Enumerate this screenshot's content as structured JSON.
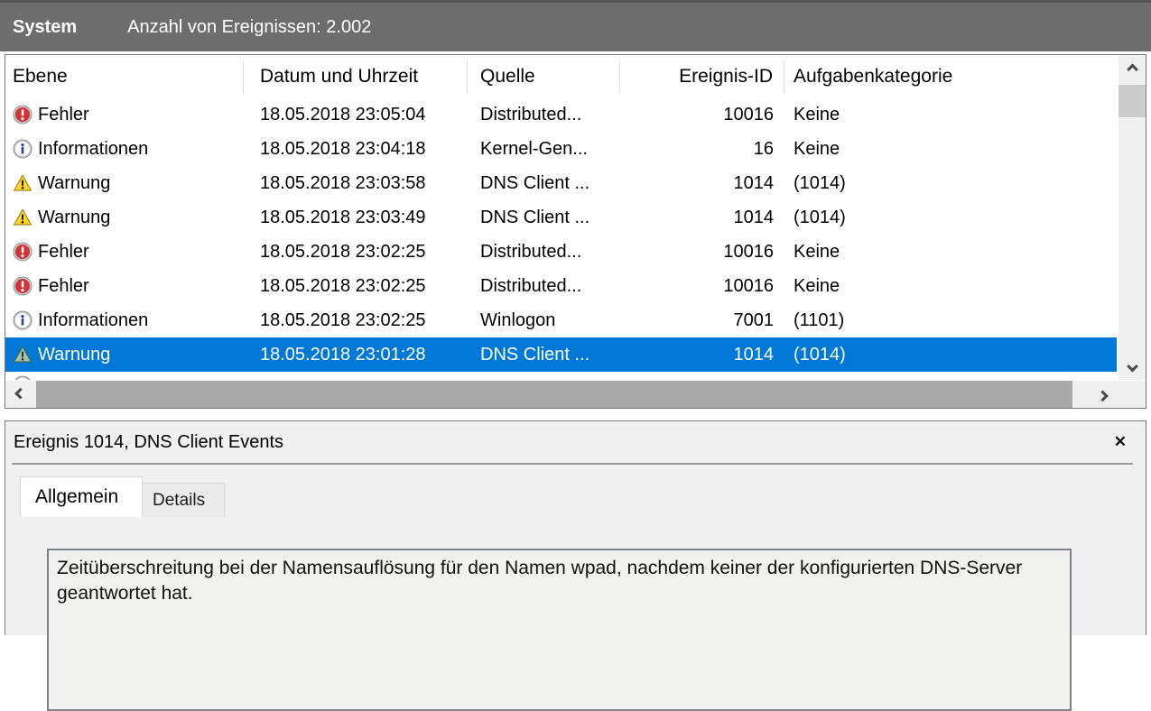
{
  "titlebar": {
    "log_name": "System",
    "event_count": "Anzahl von Ereignissen: 2.002"
  },
  "table": {
    "columns": {
      "level": "Ebene",
      "datetime": "Datum und Uhrzeit",
      "source": "Quelle",
      "event_id": "Ereignis-ID",
      "task_category": "Aufgabenkategorie"
    },
    "rows": [
      {
        "icon": "error-icon",
        "level": "Fehler",
        "datetime": "18.05.2018 23:05:04",
        "source": "Distributed...",
        "event_id": "10016",
        "task_category": "Keine",
        "selected": false
      },
      {
        "icon": "info-icon",
        "level": "Informationen",
        "datetime": "18.05.2018 23:04:18",
        "source": "Kernel-Gen...",
        "event_id": "16",
        "task_category": "Keine",
        "selected": false
      },
      {
        "icon": "warning-icon",
        "level": "Warnung",
        "datetime": "18.05.2018 23:03:58",
        "source": "DNS Client ...",
        "event_id": "1014",
        "task_category": "(1014)",
        "selected": false
      },
      {
        "icon": "warning-icon",
        "level": "Warnung",
        "datetime": "18.05.2018 23:03:49",
        "source": "DNS Client ...",
        "event_id": "1014",
        "task_category": "(1014)",
        "selected": false
      },
      {
        "icon": "error-icon",
        "level": "Fehler",
        "datetime": "18.05.2018 23:02:25",
        "source": "Distributed...",
        "event_id": "10016",
        "task_category": "Keine",
        "selected": false
      },
      {
        "icon": "error-icon",
        "level": "Fehler",
        "datetime": "18.05.2018 23:02:25",
        "source": "Distributed...",
        "event_id": "10016",
        "task_category": "Keine",
        "selected": false
      },
      {
        "icon": "info-icon",
        "level": "Informationen",
        "datetime": "18.05.2018 23:02:25",
        "source": "Winlogon",
        "event_id": "7001",
        "task_category": "(1101)",
        "selected": false
      },
      {
        "icon": "warning-icon",
        "level": "Warnung",
        "datetime": "18.05.2018 23:01:28",
        "source": "DNS Client ...",
        "event_id": "1014",
        "task_category": "(1014)",
        "selected": true
      }
    ]
  },
  "details": {
    "title": "Ereignis 1014, DNS Client Events",
    "close_glyph": "✕",
    "tabs": {
      "general": "Allgemein",
      "details": "Details"
    },
    "message": "Zeitüberschreitung bei der Namensauflösung für den Namen wpad, nachdem keiner der konfigurierten DNS-Server geantwortet hat."
  },
  "colors": {
    "selection": "#0078d7",
    "titlebar": "#6d6d6d",
    "error": "#d23436",
    "warning": "#ffd42a",
    "info": "#2b3f9e"
  }
}
